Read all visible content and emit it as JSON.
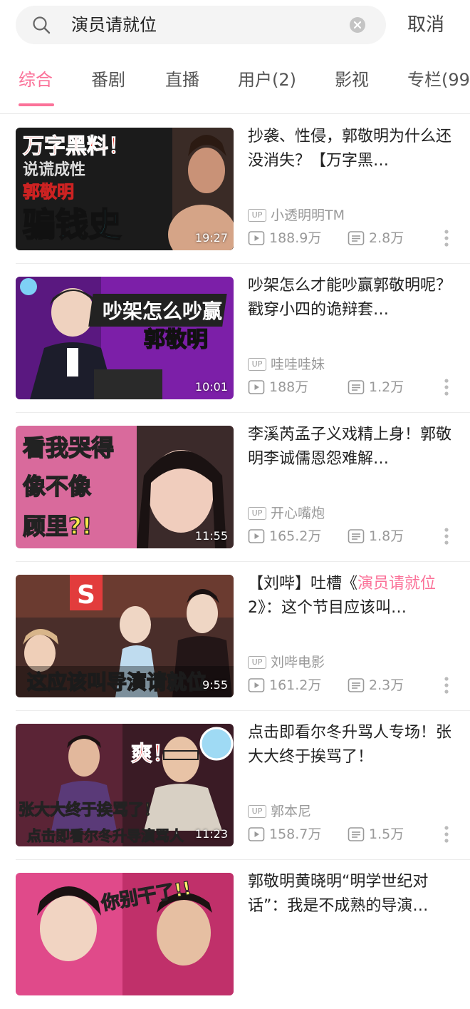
{
  "search": {
    "query": "演员请就位",
    "cancel_label": "取消"
  },
  "tabs": [
    {
      "label": "综合"
    },
    {
      "label": "番剧"
    },
    {
      "label": "直播"
    },
    {
      "label": "用户(2)"
    },
    {
      "label": "影视"
    },
    {
      "label": "专栏(99"
    }
  ],
  "colors": {
    "accent": "#fb7299"
  },
  "videos": [
    {
      "title": "抄袭、性侵，郭敬明为什么还没消失？【万字黑…",
      "uploader": "小透明明TM",
      "views": "188.9万",
      "danmaku": "2.8万",
      "duration": "19:27",
      "thumb_text": [
        "万字黑料！",
        "说谎成性",
        "郭敬明",
        "骗钱史"
      ]
    },
    {
      "title": "吵架怎么才能吵赢郭敬明呢？戳穿小四的诡辩套…",
      "uploader": "哇哇哇妹",
      "views": "188万",
      "danmaku": "1.2万",
      "duration": "10:01",
      "thumb_text": [
        "吵架怎么吵赢",
        "郭敬明"
      ]
    },
    {
      "title": "李溪芮孟子义戏精上身！郭敬明李诚儒恩怨难解…",
      "uploader": "开心嘴炮",
      "views": "165.2万",
      "danmaku": "1.8万",
      "duration": "11:55",
      "thumb_text": [
        "看我哭得",
        "像不像",
        "顾里?!"
      ]
    },
    {
      "title_pre": "【刘哔】吐槽《",
      "title_hl": "演员请就位",
      "title_post": "2》：这个节目应该叫…",
      "uploader": "刘哔电影",
      "views": "161.2万",
      "danmaku": "2.3万",
      "duration": "9:55",
      "thumb_text": [
        "S",
        "这应该叫导演请就位"
      ]
    },
    {
      "title": "点击即看尔冬升骂人专场！张大大终于挨骂了！",
      "uploader": "郭本尼",
      "views": "158.7万",
      "danmaku": "1.5万",
      "duration": "11:23",
      "thumb_text": [
        "爽！",
        "张大大终于挨骂了！",
        "点击即看尔冬升导演骂人"
      ]
    },
    {
      "title": "郭敬明黄晓明“明学世纪对话”：我是不成熟的导演…",
      "thumb_text": [
        "你别干了!!"
      ]
    }
  ],
  "labels": {
    "up_badge": "UP"
  }
}
